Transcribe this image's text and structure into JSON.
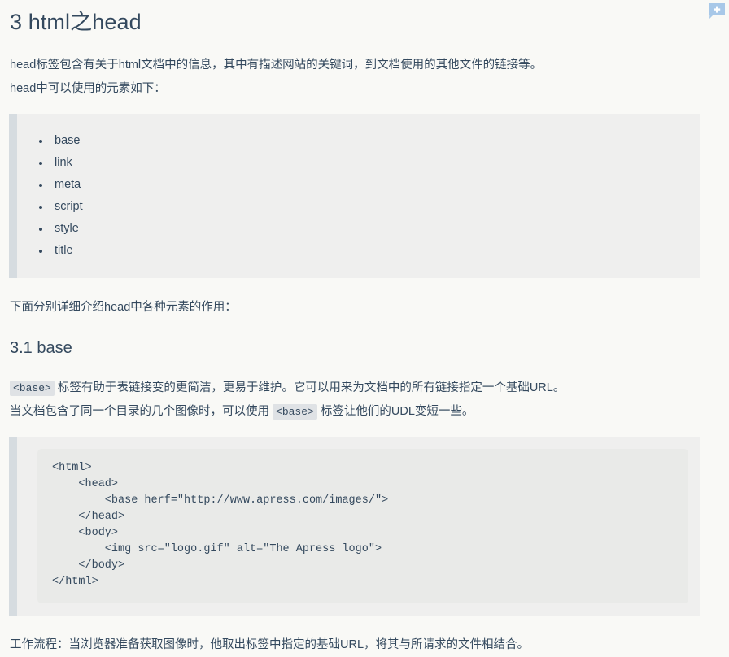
{
  "document": {
    "title": "3 html之head",
    "intro_lines": [
      "head标签包含有关于html文档中的信息，其中有描述网站的关键词，到文档使用的其他文件的链接等。",
      "head中可以使用的元素如下："
    ],
    "element_list": [
      "base",
      "link",
      "meta",
      "script",
      "style",
      "title"
    ],
    "after_list_text": "下面分别详细介绍head中各种元素的作用：",
    "section": {
      "heading": "3.1 base",
      "para1_code": "<base>",
      "para1_rest": " 标签有助于表链接变的更简洁，更易于维护。它可以用来为文档中的所有链接指定一个基础URL。",
      "para2_before": "当文档包含了同一个目录的几个图像时，可以使用 ",
      "para2_code": "<base>",
      "para2_after": " 标签让他们的UDL变短一些。",
      "code_sample": "<html>\n    <head>\n        <base herf=\"http://www.apress.com/images/\">\n    </head>\n    <body>\n        <img src=\"logo.gif\" alt=\"The Apress logo\">\n    </body>\n</html>",
      "footer_text": "工作流程：当浏览器准备获取图像时，他取出标签中指定的基础URL，将其与所请求的文件相结合。"
    }
  },
  "widgets": {
    "comment_icon_name": "add-comment-icon"
  },
  "colors": {
    "page_background": "#f9f9f6",
    "text": "#34495e",
    "quote_background": "#efefee",
    "quote_border": "#d6dce0",
    "code_background": "#e9eae8",
    "inline_code_background": "#dfe2e5",
    "comment_icon": "#a8c8e8"
  }
}
